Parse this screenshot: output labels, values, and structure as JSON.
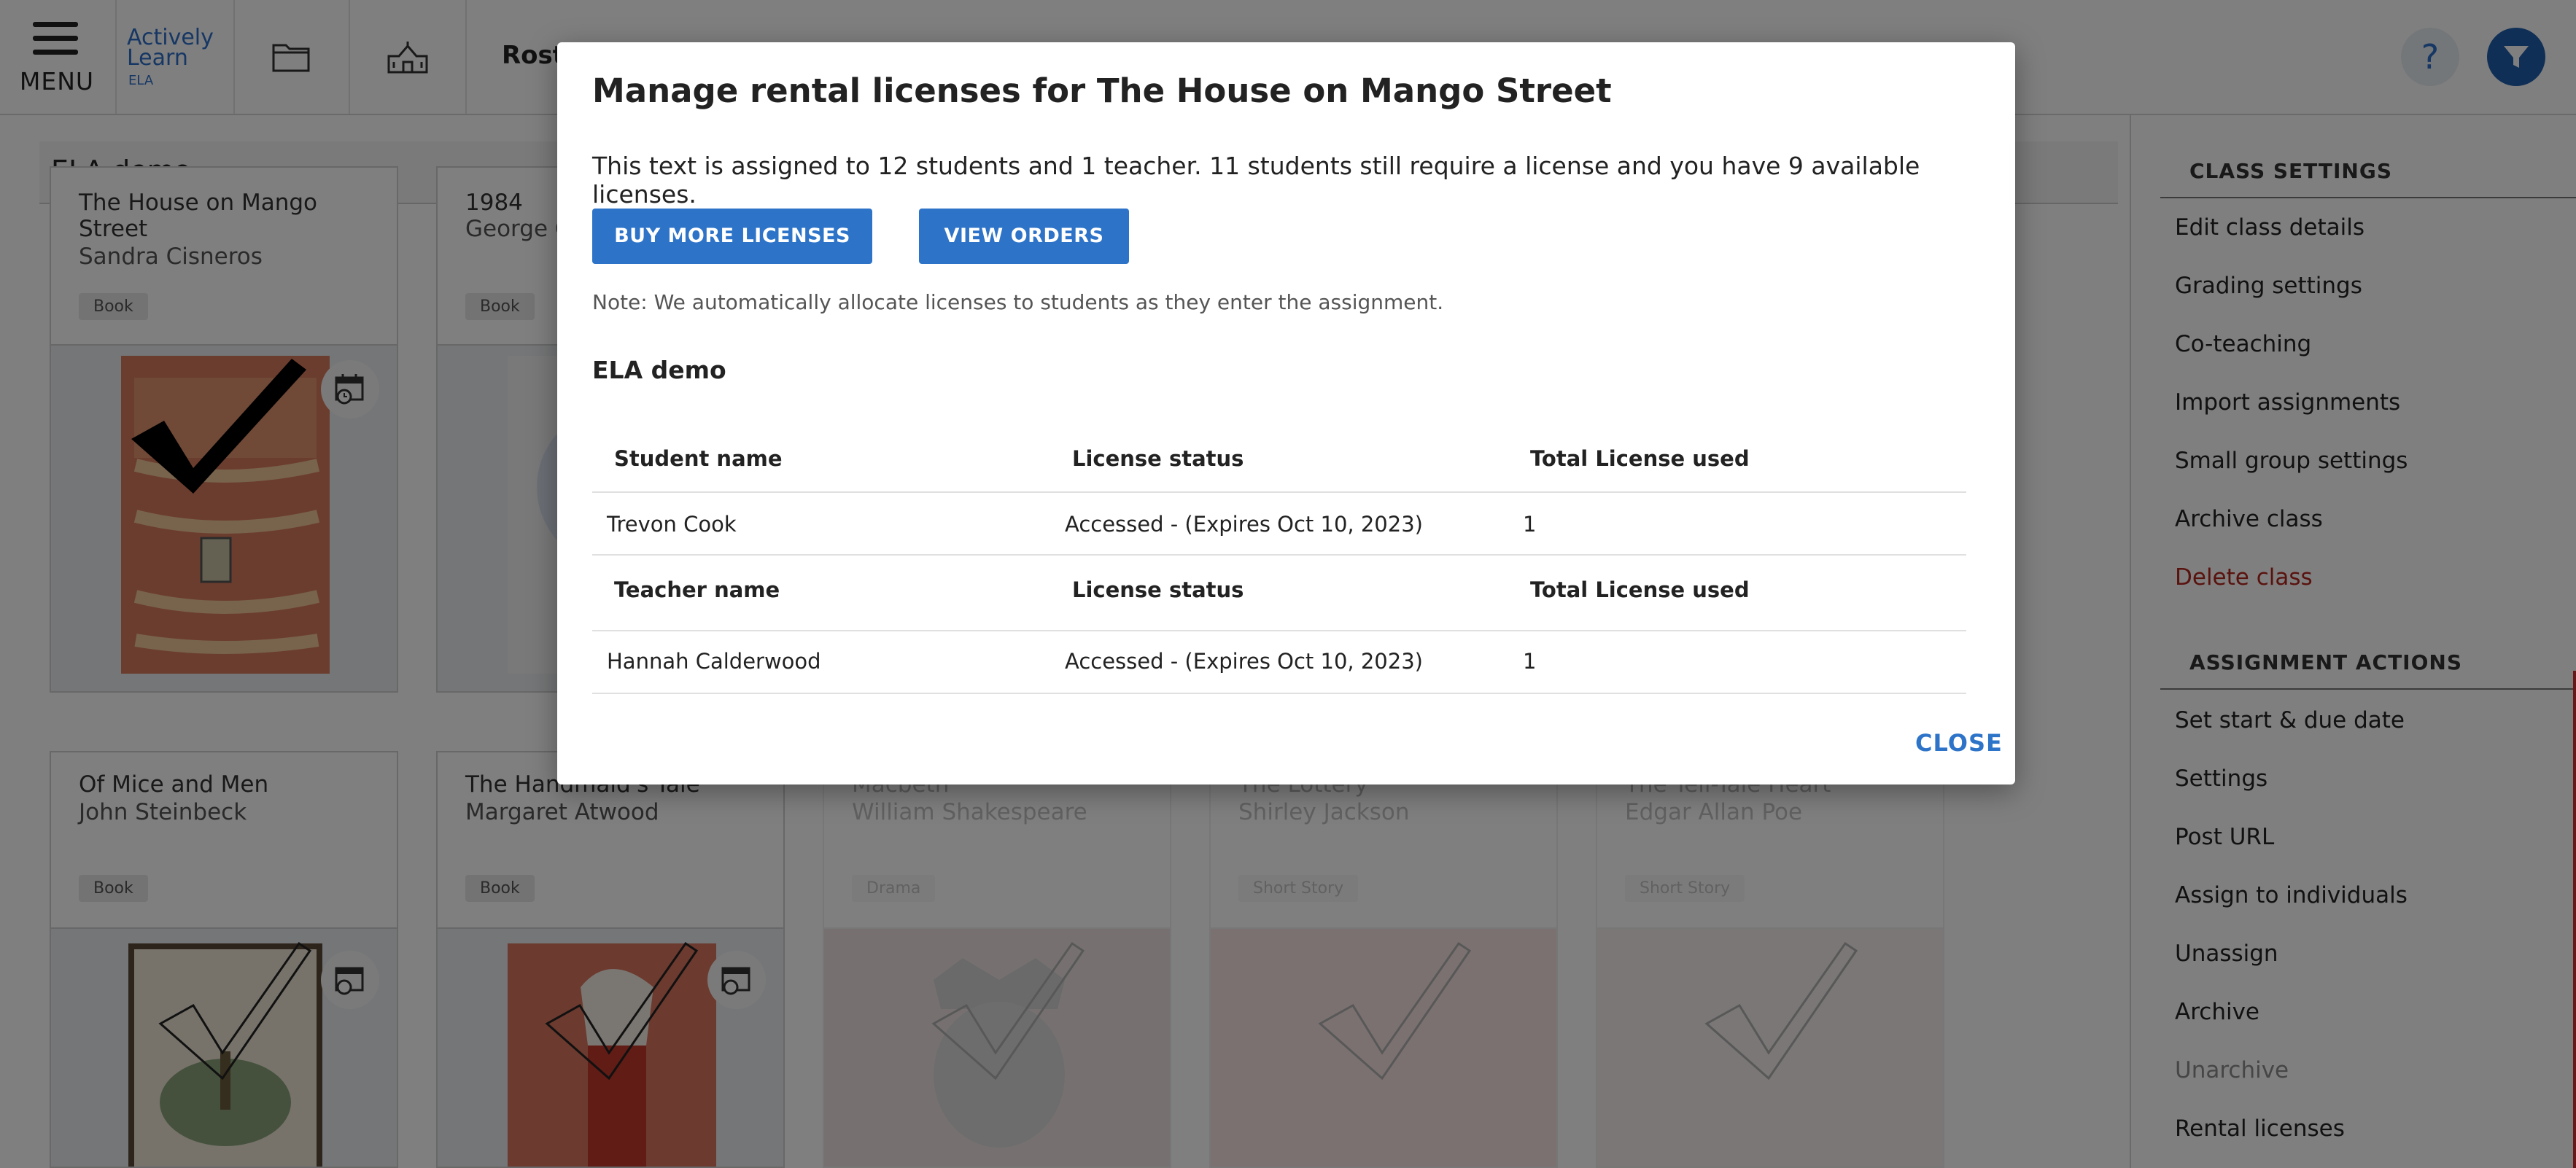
{
  "topbar": {
    "menu_label": "MENU",
    "logo_line1": "Actively",
    "logo_line2": "Learn",
    "logo_sub": "ELA",
    "roster_label_partial": "Rost",
    "help_label": "?"
  },
  "class_title": "ELA demo",
  "cards": [
    {
      "title": "The House on Mango Street",
      "author": "Sandra Cisneros",
      "type": "Book"
    },
    {
      "title": "1984",
      "author": "George O",
      "type": "Book"
    },
    {
      "title": "Of Mice and Men",
      "author": "John Steinbeck",
      "type": "Book"
    },
    {
      "title": "The Handmaid's Tale",
      "author": "Margaret Atwood",
      "type": "Book"
    },
    {
      "title": "Macbeth",
      "author": "William Shakespeare",
      "type": "Drama"
    },
    {
      "title": "The Lottery",
      "author": "Shirley Jackson",
      "type": "Short Story"
    },
    {
      "title": "The Tell-Tale Heart",
      "author": "Edgar Allan Poe",
      "type": "Short Story"
    }
  ],
  "sidebar": {
    "class_settings_heading": "CLASS SETTINGS",
    "class_settings": [
      "Edit class details",
      "Grading settings",
      "Co-teaching",
      "Import assignments",
      "Small group settings",
      "Archive class",
      "Delete class"
    ],
    "assignment_actions_heading": "ASSIGNMENT ACTIONS",
    "assignment_actions": [
      "Set start & due date",
      "Settings",
      "Post URL",
      "Assign to individuals",
      "Unassign",
      "Archive",
      "Unarchive",
      "Rental licenses"
    ]
  },
  "modal": {
    "title": "Manage rental licenses for The House on Mango Street",
    "description": "This text is assigned to 12 students and 1 teacher. 11 students still require a license and you have 9 available licenses.",
    "buy_button": "BUY MORE LICENSES",
    "orders_button": "VIEW ORDERS",
    "note": "Note: We automatically allocate licenses to students as they enter the assignment.",
    "class_name": "ELA demo",
    "student_headers": [
      "Student name",
      "License status",
      "Total License used"
    ],
    "student_rows": [
      {
        "name": "Trevon Cook",
        "status": "Accessed - (Expires Oct 10, 2023)",
        "used": "1"
      }
    ],
    "teacher_headers": [
      "Teacher name",
      "License status",
      "Total License used"
    ],
    "teacher_rows": [
      {
        "name": "Hannah Calderwood",
        "status": "Accessed - (Expires Oct 10, 2023)",
        "used": "1"
      }
    ],
    "close_button": "CLOSE"
  },
  "colors": {
    "accent": "#2d74c9",
    "danger": "#b3261e",
    "overlay": "rgba(0,0,0,0.5)"
  }
}
